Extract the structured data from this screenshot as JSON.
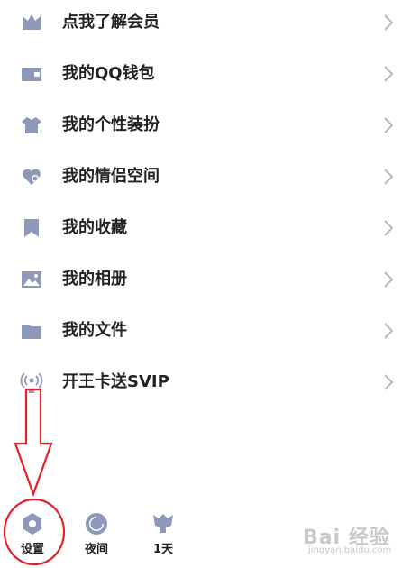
{
  "menu": {
    "items": [
      {
        "label": "点我了解会员",
        "icon": "vip-crown-icon"
      },
      {
        "label": "我的QQ钱包",
        "icon": "wallet-icon"
      },
      {
        "label": "我的个性装扮",
        "icon": "shirt-icon"
      },
      {
        "label": "我的情侣空间",
        "icon": "couple-heart-icon"
      },
      {
        "label": "我的收藏",
        "icon": "bookmark-icon"
      },
      {
        "label": "我的相册",
        "icon": "photo-album-icon"
      },
      {
        "label": "我的文件",
        "icon": "folder-icon"
      },
      {
        "label": "开王卡送SVIP",
        "icon": "signal-card-icon"
      }
    ]
  },
  "bottom_bar": {
    "settings_label": "设置",
    "night_label": "夜间",
    "days_label": "1天"
  },
  "watermark": {
    "main": "Bai 经验",
    "sub": "jingyan.baidu.com"
  },
  "colors": {
    "icon": "#8e98b8",
    "chevron": "#b9b9b9",
    "annotation": "#e0202a"
  }
}
